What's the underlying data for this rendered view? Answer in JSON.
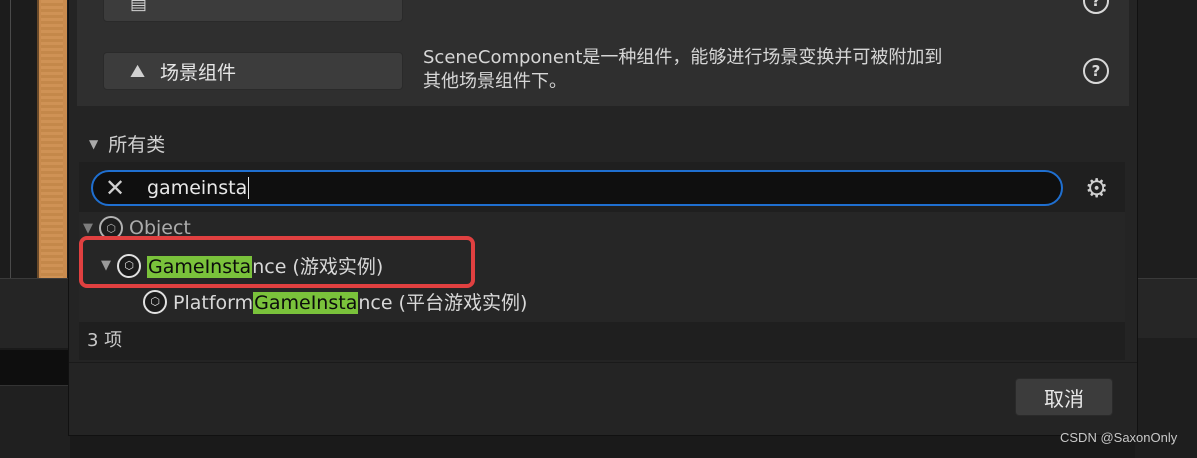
{
  "components": [
    {
      "label": "",
      "description": "",
      "partial": true
    },
    {
      "label": "场景组件",
      "description_line1": "SceneComponent是一种组件，能够进行场景变换并可被附加到",
      "description_line2": "其他场景组件下。",
      "help": "?"
    }
  ],
  "all_classes": {
    "header": "所有类",
    "search_value": "gameinsta",
    "tree": {
      "object": "Object",
      "game_instance": {
        "match": "GameInsta",
        "rest": "nce (游戏实例)"
      },
      "platform_game_instance": {
        "prefix": "Platform",
        "match": "GameInsta",
        "rest": "nce (平台游戏实例)"
      }
    },
    "count": "3 项"
  },
  "footer": {
    "cancel_label": "取消"
  },
  "watermark": "CSDN @SaxonOnly",
  "colors": {
    "highlight": "#7ac23b",
    "focus": "#1f6fd0",
    "annotation": "#e04040"
  }
}
